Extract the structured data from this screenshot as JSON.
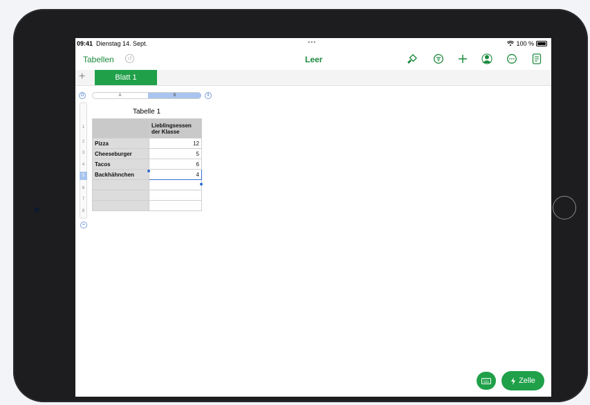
{
  "status": {
    "time": "09:41",
    "date": "Dienstag 14. Sept.",
    "dots": "•••",
    "battery": "100 %"
  },
  "toolbar": {
    "back_label": "Tabellen",
    "title": "Leer"
  },
  "tabs": {
    "add": "+",
    "active_sheet": "Blatt 1"
  },
  "grid": {
    "col_a": "A",
    "col_b": "B",
    "pause": "II",
    "ring": "O",
    "eq": "=",
    "row_numbers": [
      "1",
      "2",
      "3",
      "4",
      "5",
      "6",
      "7",
      "8"
    ],
    "table_title": "Tabelle 1",
    "header_b": "Lieblingsessen der Klasse",
    "rows": [
      {
        "label": "Pizza",
        "value": "12"
      },
      {
        "label": "Cheeseburger",
        "value": "5"
      },
      {
        "label": "Tacos",
        "value": "6"
      },
      {
        "label": "Backhähnchen",
        "value": "4"
      }
    ]
  },
  "bottom": {
    "zelle_label": "Zelle"
  },
  "colors": {
    "accent": "#1fa049",
    "selection": "#2f6fd1"
  }
}
